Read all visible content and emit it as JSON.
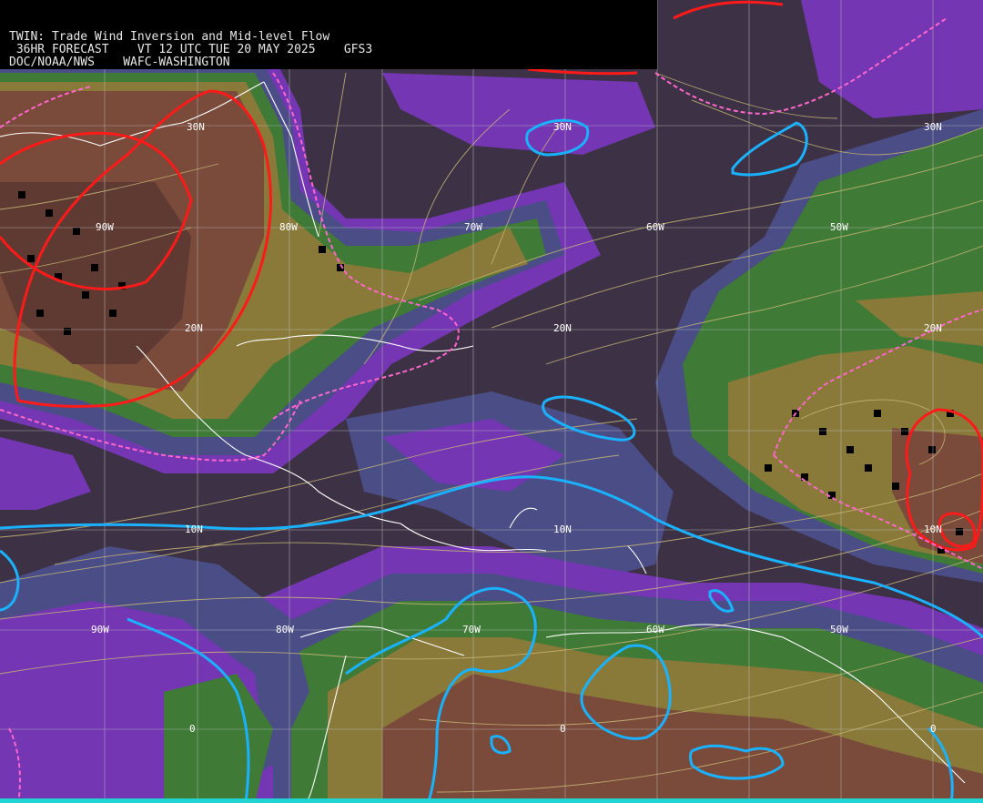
{
  "header": {
    "line1": "TWIN: Trade Wind Inversion and Mid-level Flow",
    "line2": " 36HR FORECAST    VT 12 UTC TUE 20 MAY 2025    GFS3",
    "line3": "DOC/NOAA/NWS    WAFC-WASHINGTON"
  },
  "map_labels": {
    "lat30_left": "30N",
    "lat30_mid": "30N",
    "lat30_right": "30N",
    "lon_90w": "90W",
    "lon_80w": "80W",
    "lon_70w": "70W",
    "lon_60w": "60W",
    "lon_50w": "50W",
    "lat20_left": "20N",
    "lat20_mid": "20N",
    "lat20_right": "20N",
    "lat10_left": "10N",
    "lat10_mid": "10N",
    "lat10_right": "10N",
    "lon_90w_s": "90W",
    "lon_80w_s": "80W",
    "lon_70w_s": "70W",
    "lon_60w_s": "60W",
    "lon_50w_s": "50W",
    "eq_left": "0",
    "eq_mid": "0",
    "eq_right": "0"
  },
  "colors": {
    "background": "#3d3245",
    "purple": "#7436b3",
    "blue_gray": "#4a4d86",
    "green": "#3f7a36",
    "olive": "#8a7a3a",
    "brown": "#7a4a3a",
    "red_contour": "#ff1a1a",
    "pink_dashed": "#ff66cc",
    "cyan_contour": "#1ab2ff",
    "streamline": "#c8b878",
    "coastline": "#ffffff",
    "grid": "#c0c0c0"
  }
}
